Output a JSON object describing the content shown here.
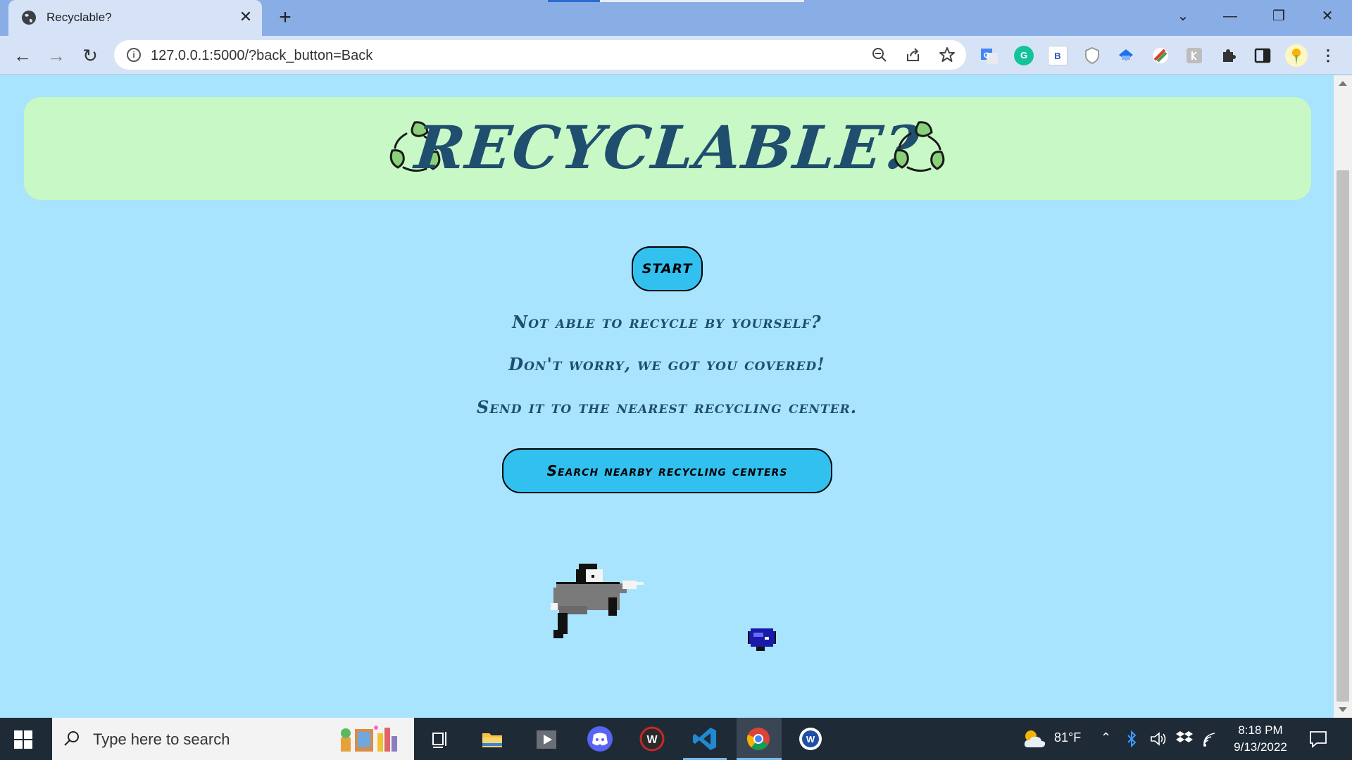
{
  "browser": {
    "tab_title": "Recyclable?",
    "tab_close": "✕",
    "new_tab": "+",
    "url": "127.0.0.1:5000/?back_button=Back",
    "window_controls": {
      "minimize": "—",
      "restore": "❐",
      "close": "✕",
      "tab_search": "⌄"
    },
    "nav": {
      "back": "←",
      "forward": "→",
      "reload": "↻"
    },
    "omnibox_icons": [
      "zoom-out-icon",
      "share-icon",
      "bookmark-star-icon"
    ],
    "extensions": [
      "google-translate-icon",
      "grammarly-icon",
      "b-extension-icon",
      "shield-extension-icon",
      "blue-extension-icon",
      "color-extension-icon",
      "grey-extension-icon",
      "puzzle-extensions-icon",
      "side-panel-icon",
      "profile-avatar",
      "menu-icon"
    ],
    "ext_b_label": "B",
    "ext_g_label": "G"
  },
  "page": {
    "title": "RECYCLABLE?",
    "start_label": "START",
    "messages": [
      "Not able to recycle by yourself?",
      "Don't worry, we got you covered!",
      "Send it to the nearest recycling center."
    ],
    "search_label": "Search nearby recycling centers",
    "colors": {
      "background": "#a8e4fd",
      "banner": "#c8f8c6",
      "title": "#1f4e6e",
      "button": "#32c0ef"
    }
  },
  "taskbar": {
    "search_placeholder": "Type here to search",
    "apps": [
      "task-view-icon",
      "file-explorer-icon",
      "media-player-icon",
      "discord-icon",
      "w-app-icon",
      "vscode-icon",
      "chrome-icon",
      "w-circle-app-icon"
    ],
    "weather": "81°F",
    "time": "8:18 PM",
    "date": "9/13/2022"
  }
}
